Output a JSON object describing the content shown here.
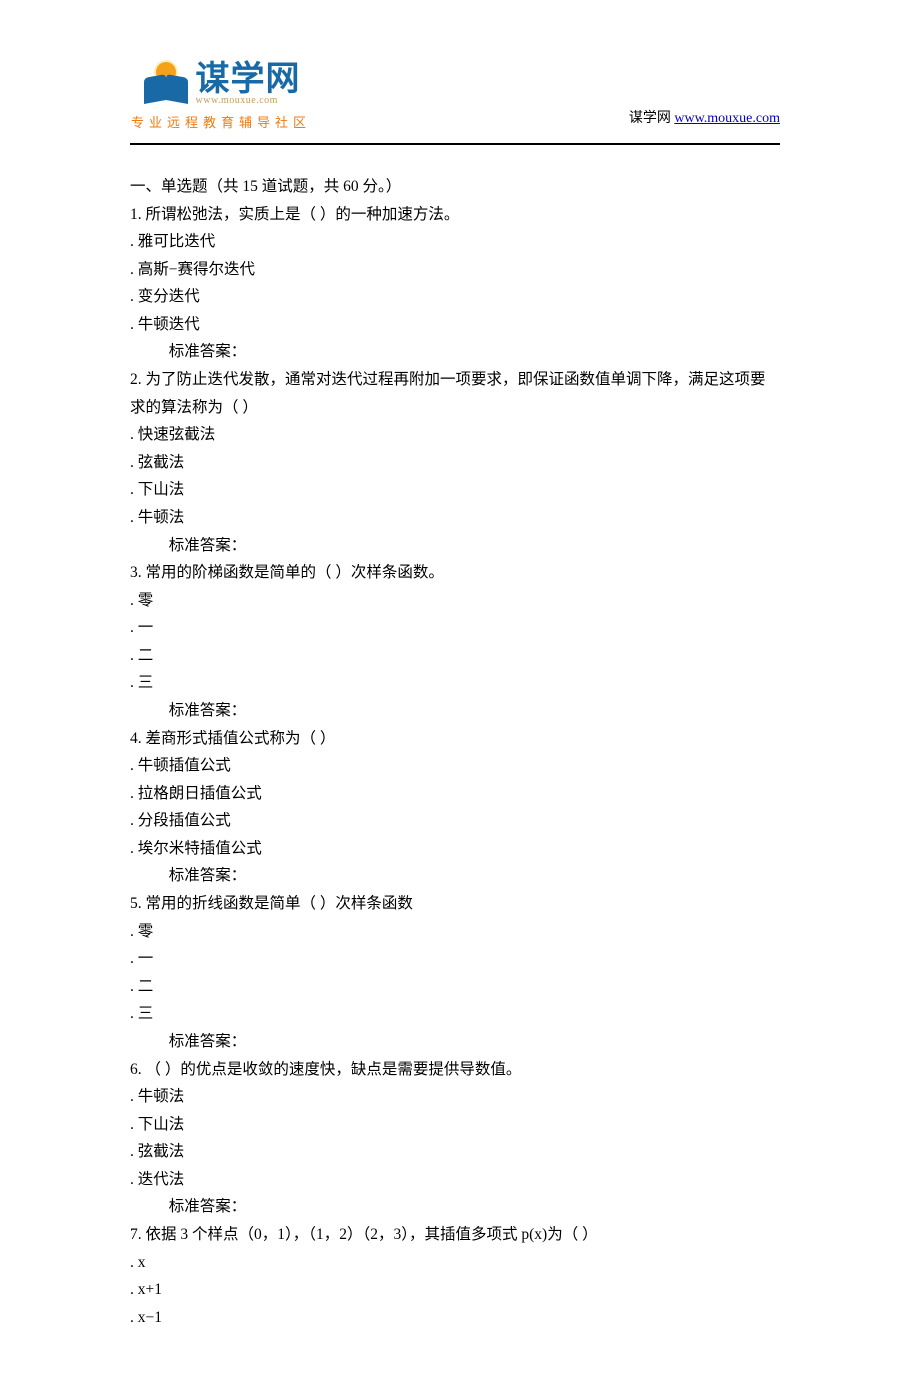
{
  "header": {
    "logo_main": "谋学网",
    "logo_url_sub": "www.mouxue.com",
    "logo_slogan": "专业远程教育辅导社区",
    "site_label": "谋学网 ",
    "site_url": "www.mouxue.com"
  },
  "section_title": "一、单选题（共 15 道试题，共 60 分。）",
  "answer_label": "标准答案：",
  "questions": [
    {
      "stem": "1.  所谓松弛法，实质上是（ ）的一种加速方法。",
      "options": [
        ".  雅可比迭代",
        ".  高斯−赛得尔迭代",
        ".  变分迭代",
        ".  牛顿迭代"
      ]
    },
    {
      "stem": "2.  为了防止迭代发散，通常对迭代过程再附加一项要求，即保证函数值单调下降，满足这项要求的算法称为（ ）",
      "options": [
        ".  快速弦截法",
        ".  弦截法",
        ".  下山法",
        ".  牛顿法"
      ]
    },
    {
      "stem": "3.  常用的阶梯函数是简单的（ ）次样条函数。",
      "options": [
        ".  零",
        ".  一",
        ".  二",
        ".  三"
      ]
    },
    {
      "stem": "4.  差商形式插值公式称为（ ）",
      "options": [
        ".  牛顿插值公式",
        ".  拉格朗日插值公式",
        ".  分段插值公式",
        ".  埃尔米特插值公式"
      ]
    },
    {
      "stem": "5.  常用的折线函数是简单（ ）次样条函数",
      "options": [
        ".  零",
        ".  一",
        ".  二",
        ".  三"
      ]
    },
    {
      "stem": "6.  （ ）的优点是收敛的速度快，缺点是需要提供导数值。",
      "options": [
        ".  牛顿法",
        ".  下山法",
        ".  弦截法",
        ".  迭代法"
      ]
    },
    {
      "stem": "7.  依据 3 个样点（0，1），（1，2）（2，3），其插值多项式 p(x)为（ ）",
      "options": [
        ".  x",
        ".  x+1",
        ".  x−1"
      ]
    }
  ]
}
